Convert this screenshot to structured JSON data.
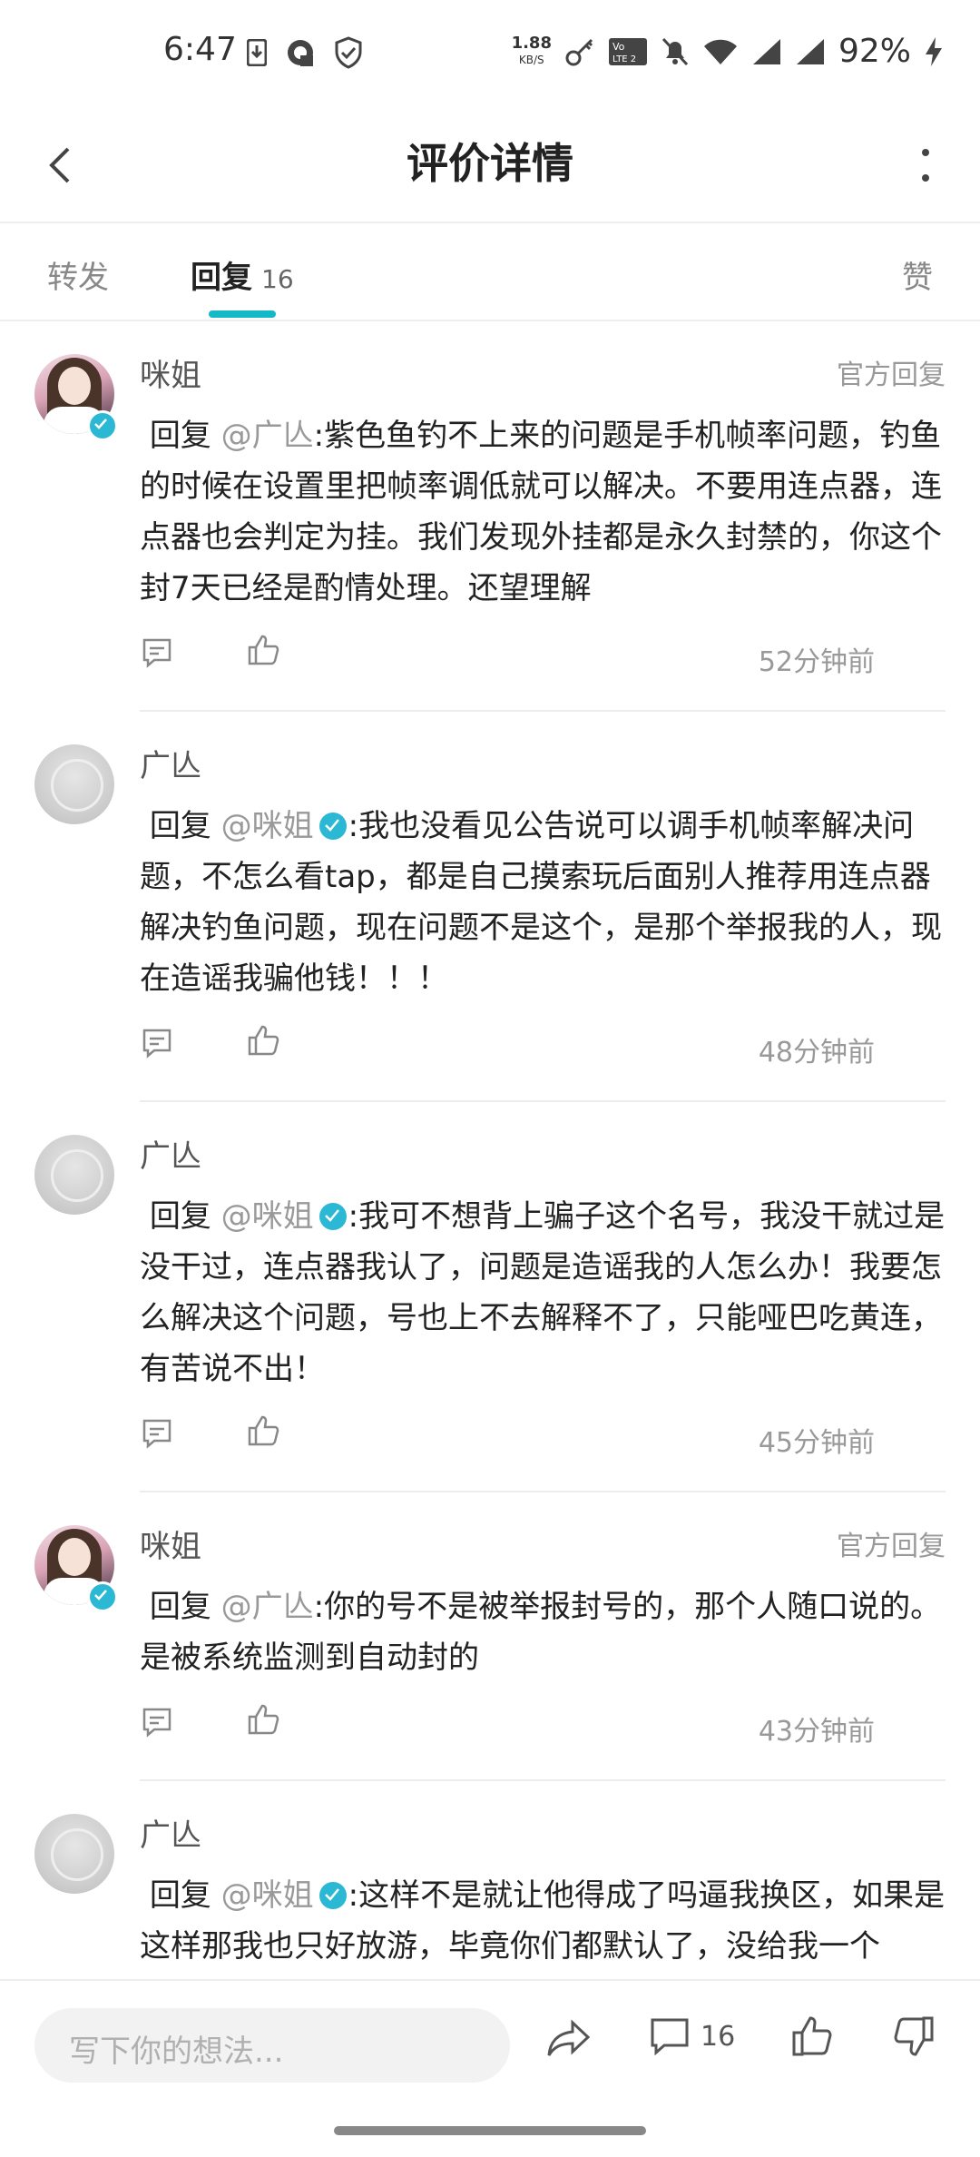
{
  "status_bar": {
    "time": "6:47",
    "speed_value": "1.88",
    "speed_unit": "KB/S",
    "battery": "92%",
    "icons": [
      "download-icon",
      "app-icon",
      "shield-icon",
      "key-icon",
      "volte-icon",
      "mute-icon",
      "wifi-icon",
      "signal-icon",
      "signal-icon",
      "charging-icon"
    ]
  },
  "header": {
    "title": "评价详情"
  },
  "tabs": {
    "forward": "转发",
    "reply": "回复",
    "reply_count": "16",
    "like": "赞"
  },
  "comments": [
    {
      "author": "咪姐",
      "official": true,
      "official_label": "官方回复",
      "reply_prefix": "回复",
      "mention": "@广亾",
      "mention_verified": false,
      "text": ":紫色鱼钓不上来的问题是手机帧率问题，钓鱼的时候在设置里把帧率调低就可以解决。不要用连点器，连点器也会判定为挂。我们发现外挂都是永久封禁的，你这个封7天已经是酌情处理。还望理解",
      "time": "52分钟前"
    },
    {
      "author": "广亾",
      "official": false,
      "official_label": "",
      "reply_prefix": "回复",
      "mention": "@咪姐",
      "mention_verified": true,
      "text": ":我也没看见公告说可以调手机帧率解决问题，不怎么看tap，都是自己摸索玩后面别人推荐用连点器解决钓鱼问题，现在问题不是这个，是那个举报我的人，现在造谣我骗他钱！！！",
      "time": "48分钟前"
    },
    {
      "author": "广亾",
      "official": false,
      "official_label": "",
      "reply_prefix": "回复",
      "mention": "@咪姐",
      "mention_verified": true,
      "text": ":我可不想背上骗子这个名号，我没干就过是没干过，连点器我认了，问题是造谣我的人怎么办！我要怎么解决这个问题，号也上不去解释不了，只能哑巴吃黄连，有苦说不出！",
      "time": "45分钟前"
    },
    {
      "author": "咪姐",
      "official": true,
      "official_label": "官方回复",
      "reply_prefix": "回复",
      "mention": "@广亾",
      "mention_verified": false,
      "text": ":你的号不是被举报封号的，那个人随口说的。是被系统监测到自动封的",
      "time": "43分钟前"
    },
    {
      "author": "广亾",
      "official": false,
      "official_label": "",
      "reply_prefix": "回复",
      "mention": "@咪姐",
      "mention_verified": true,
      "text": ":这样不是就让他得成了吗逼我换区，如果是这样那我也只好放游，毕竟你们都默认了，没给我一个",
      "time": ""
    }
  ],
  "bottom_bar": {
    "input_placeholder": "写下你的想法...",
    "comment_count": "16"
  },
  "colors": {
    "accent": "#14b9c8",
    "verify_badge": "#2bb8d4",
    "muted_text": "#999999"
  }
}
